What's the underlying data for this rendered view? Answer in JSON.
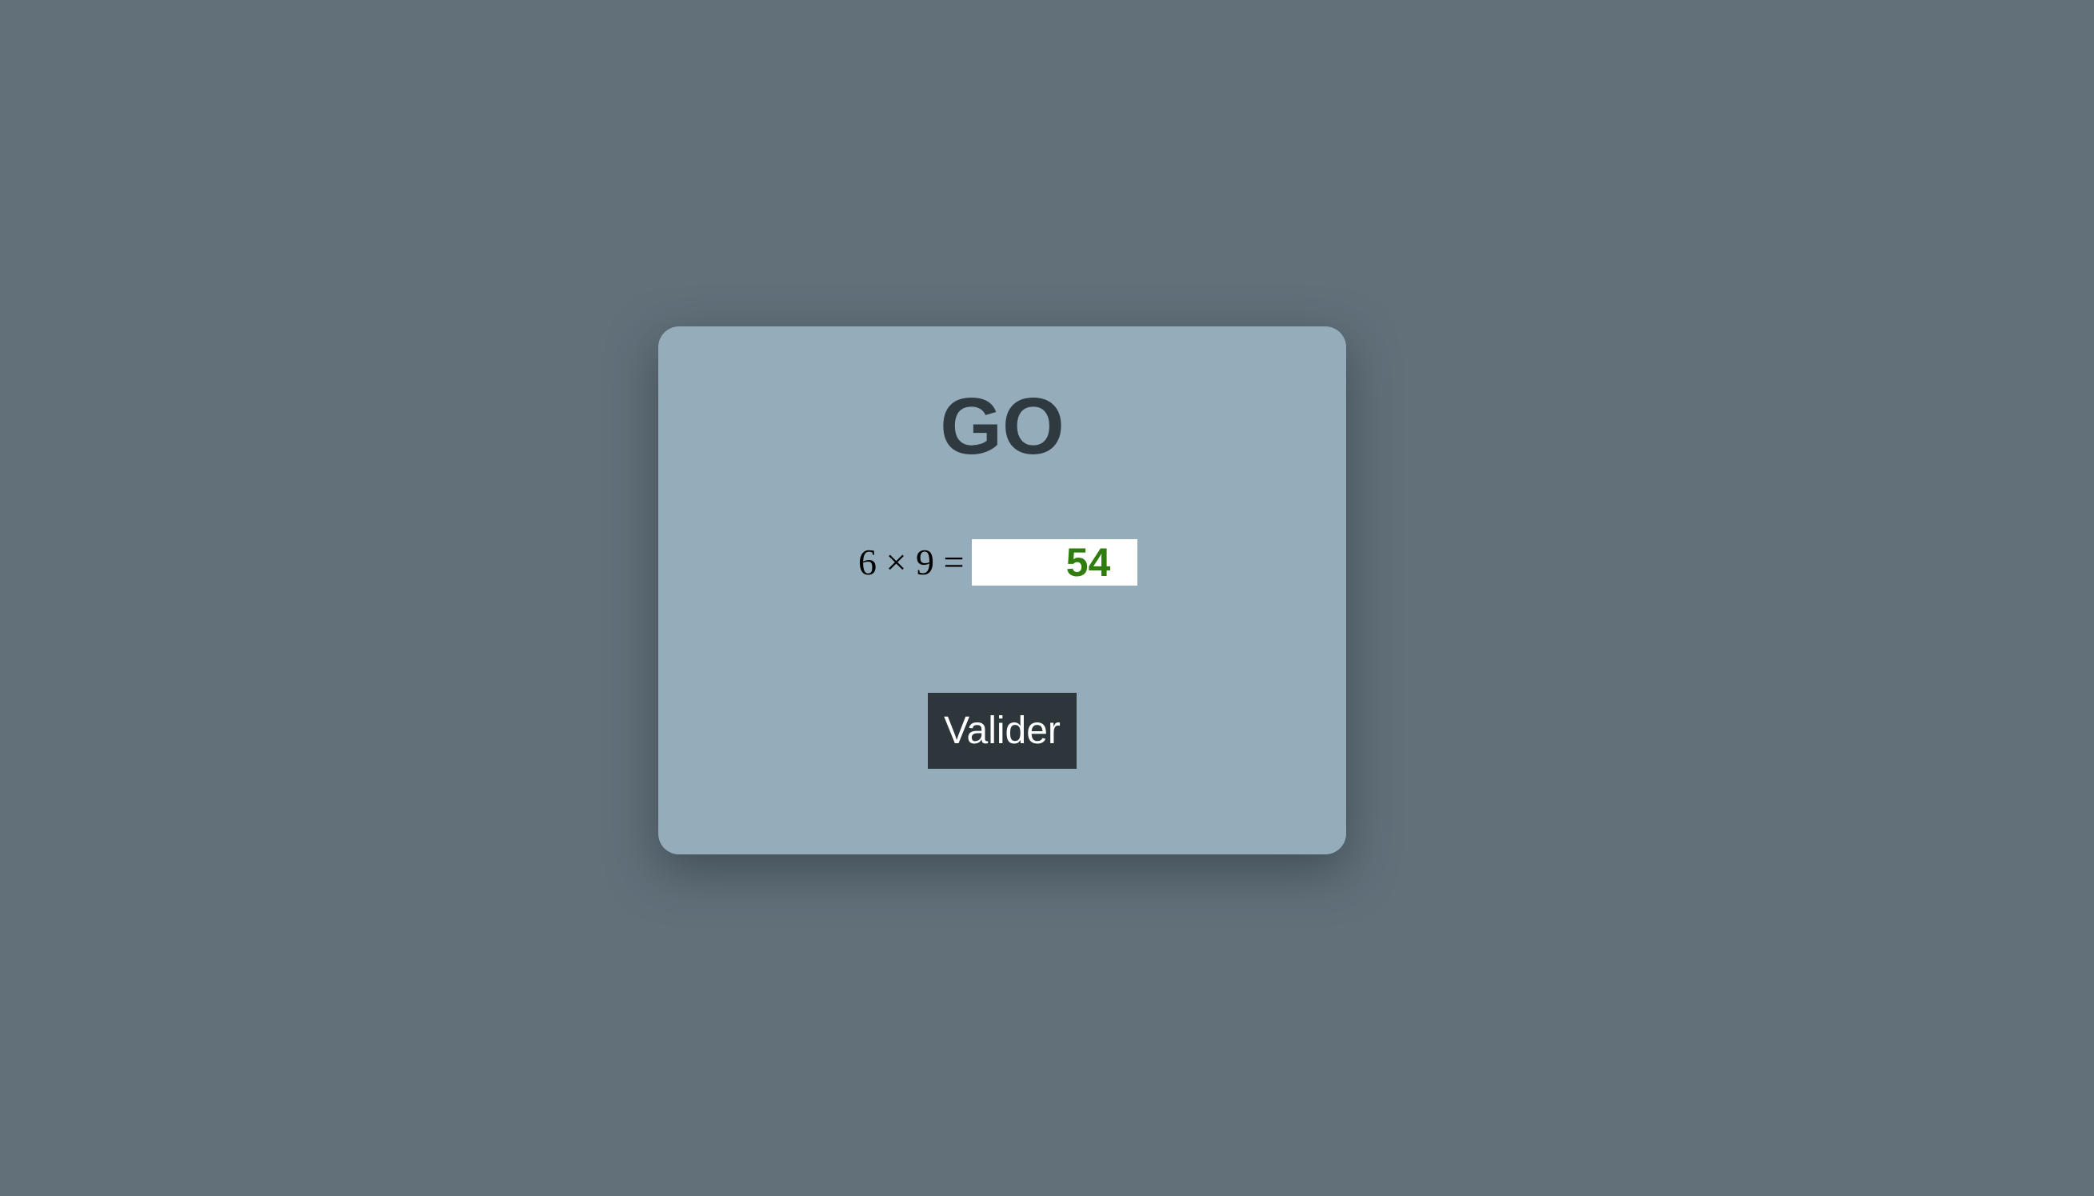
{
  "card": {
    "title": "GO",
    "question": {
      "expression": "6 × 9 =",
      "answer_value": "54"
    },
    "submit_label": "Valider"
  },
  "colors": {
    "background": "#617079",
    "card": "#95adba",
    "title": "#2f3a40",
    "answer_correct": "#2f7d0f",
    "button": "#2c363b",
    "button_text": "#ffffff"
  }
}
